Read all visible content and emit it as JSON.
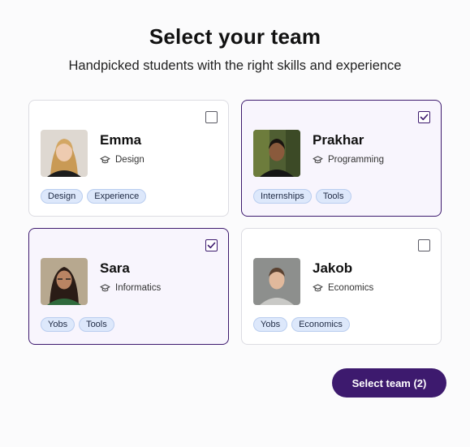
{
  "header": {
    "title": "Select your team",
    "subtitle": "Handpicked students with the right skills and experience"
  },
  "cards": [
    {
      "name": "Emma",
      "field": "Design",
      "tags": [
        "Design",
        "Experience"
      ],
      "selected": false,
      "avatar": "emma-photo"
    },
    {
      "name": "Prakhar",
      "field": "Programming",
      "tags": [
        "Internships",
        "Tools"
      ],
      "selected": true,
      "avatar": "prakhar-photo"
    },
    {
      "name": "Sara",
      "field": "Informatics",
      "tags": [
        "Yobs",
        "Tools"
      ],
      "selected": true,
      "avatar": "sara-photo"
    },
    {
      "name": "Jakob",
      "field": "Economics",
      "tags": [
        "Yobs",
        "Economics"
      ],
      "selected": false,
      "avatar": "jakob-photo"
    }
  ],
  "action": {
    "label": "Select team (2)"
  },
  "colors": {
    "accent": "#3d1a6e",
    "selected_card_bg": "#f8f5fd",
    "tag_bg": "#dde8fb",
    "tag_border": "#b9cdef"
  },
  "icons": {
    "field_icon": "graduation-cap-icon",
    "checkbox_mark": "checkmark-icon"
  }
}
